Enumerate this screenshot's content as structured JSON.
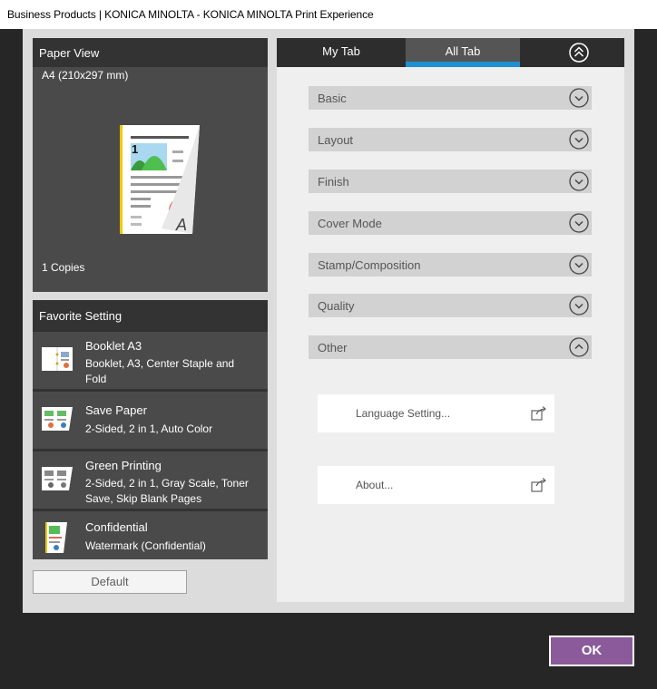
{
  "window": {
    "title": "Business Products | KONICA MINOLTA - KONICA MINOLTA Print Experience"
  },
  "paper_view": {
    "header": "Paper View",
    "paper_size": "A4 (210x297 mm)",
    "copies": "1 Copies",
    "page_number": "1",
    "preview_letter": "A"
  },
  "favorites": {
    "header": "Favorite Setting",
    "items": [
      {
        "name": "Booklet A3",
        "desc": "Booklet, A3, Center Staple and Fold",
        "icon": "booklet-icon"
      },
      {
        "name": "Save Paper",
        "desc": "2-Sided, 2 in 1, Auto Color",
        "icon": "save-paper-icon"
      },
      {
        "name": "Green Printing",
        "desc": "2-Sided, 2 in 1, Gray Scale, Toner Save, Skip Blank Pages",
        "icon": "green-printing-icon"
      },
      {
        "name": "Confidential",
        "desc": "Watermark (Confidential)",
        "icon": "confidential-icon"
      }
    ],
    "default_label": "Default"
  },
  "tabs": {
    "items": [
      {
        "label": "My Tab",
        "active": false
      },
      {
        "label": "All Tab",
        "active": true
      }
    ],
    "accent_color": "#1e90d0"
  },
  "sections": [
    {
      "label": "Basic",
      "expanded": false
    },
    {
      "label": "Layout",
      "expanded": false
    },
    {
      "label": "Finish",
      "expanded": false
    },
    {
      "label": "Cover Mode",
      "expanded": false
    },
    {
      "label": "Stamp/Composition",
      "expanded": false
    },
    {
      "label": "Quality",
      "expanded": false
    },
    {
      "label": "Other",
      "expanded": true
    }
  ],
  "other_actions": [
    {
      "label": "Language Setting..."
    },
    {
      "label": "About..."
    }
  ],
  "footer": {
    "ok_label": "OK",
    "ok_color": "#8a5a9a"
  }
}
